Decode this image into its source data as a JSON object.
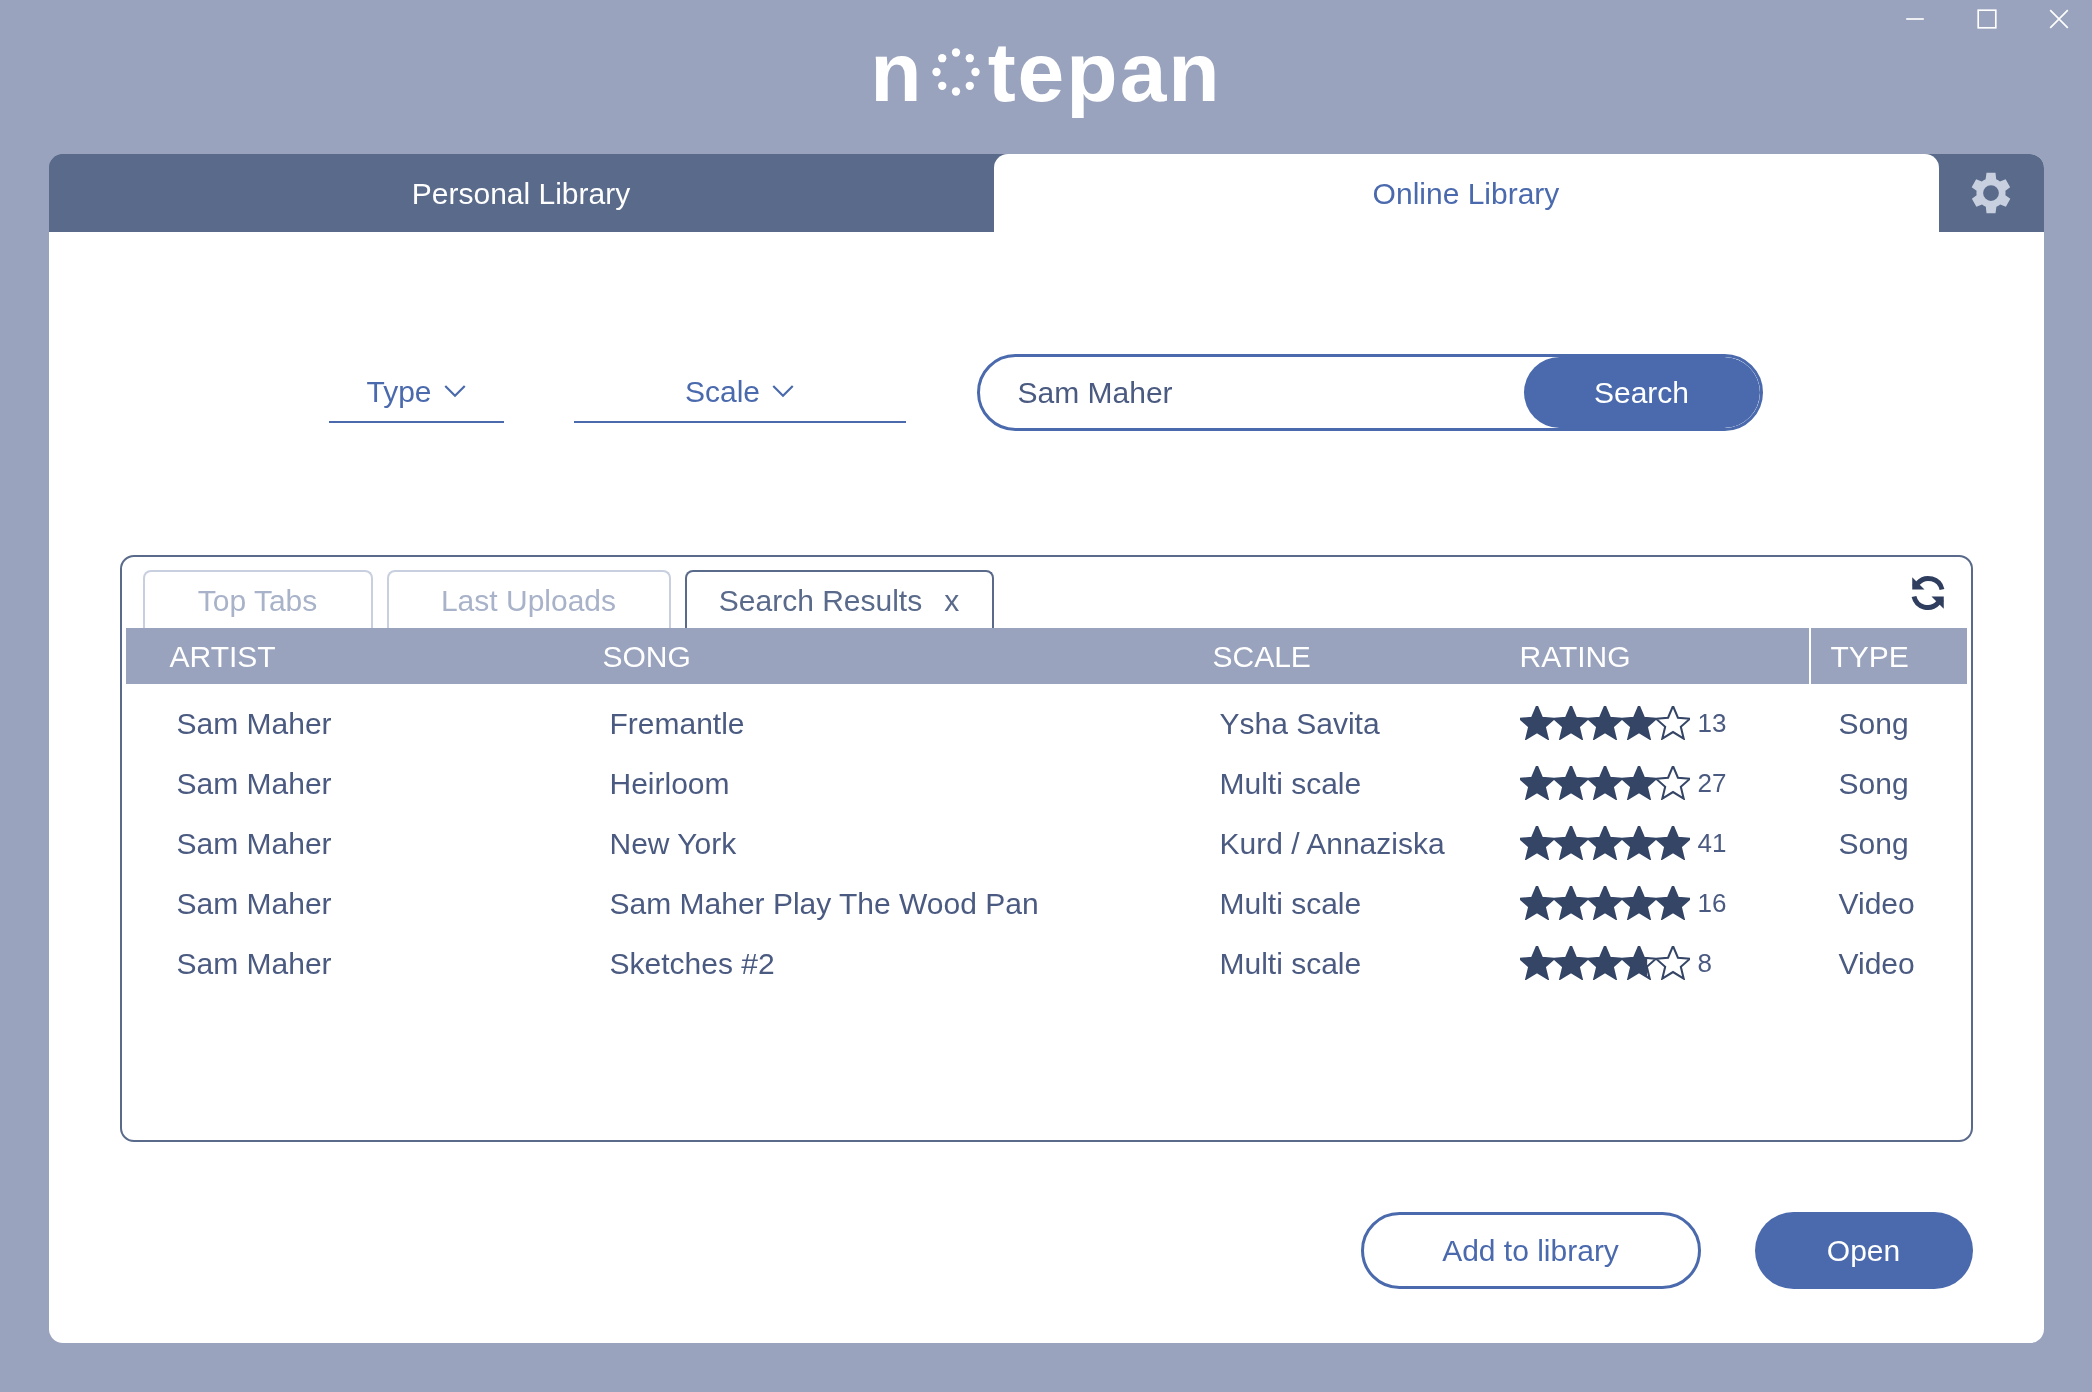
{
  "logo": {
    "before": "n",
    "after": "tepan"
  },
  "main_tabs": [
    {
      "label": "Personal Library",
      "selected": false
    },
    {
      "label": "Online Library",
      "selected": true
    }
  ],
  "filters": [
    {
      "label": "Type"
    },
    {
      "label": "Scale"
    }
  ],
  "search": {
    "value": "Sam Maher",
    "button": "Search"
  },
  "result_tabs": [
    {
      "label": "Top Tabs",
      "selected": false
    },
    {
      "label": "Last Uploads",
      "selected": false
    },
    {
      "label": "Search Results",
      "selected": true,
      "close": "x"
    }
  ],
  "table": {
    "columns": [
      "ARTIST",
      "SONG",
      "SCALE",
      "RATING",
      "TYPE"
    ],
    "rows": [
      {
        "artist": "Sam Maher",
        "song": "Fremantle",
        "scale": "Ysha Savita",
        "stars": 4,
        "count": "13",
        "type": "Song"
      },
      {
        "artist": "Sam Maher",
        "song": "Heirloom",
        "scale": "Multi scale",
        "stars": 4,
        "count": "27",
        "type": "Song"
      },
      {
        "artist": "Sam Maher",
        "song": "New York",
        "scale": "Kurd / Annaziska",
        "stars": 5,
        "count": "41",
        "type": "Song"
      },
      {
        "artist": "Sam Maher",
        "song": "Sam Maher Play The Wood Pan",
        "scale": "Multi scale",
        "stars": 5,
        "count": "16",
        "type": "Video"
      },
      {
        "artist": "Sam Maher",
        "song": "Sketches #2",
        "scale": "Multi scale",
        "stars": 3.7,
        "count": "8",
        "type": "Video"
      }
    ]
  },
  "buttons": [
    {
      "label": "Add to library",
      "kind": "outline"
    },
    {
      "label": "Open",
      "kind": "filled"
    }
  ]
}
